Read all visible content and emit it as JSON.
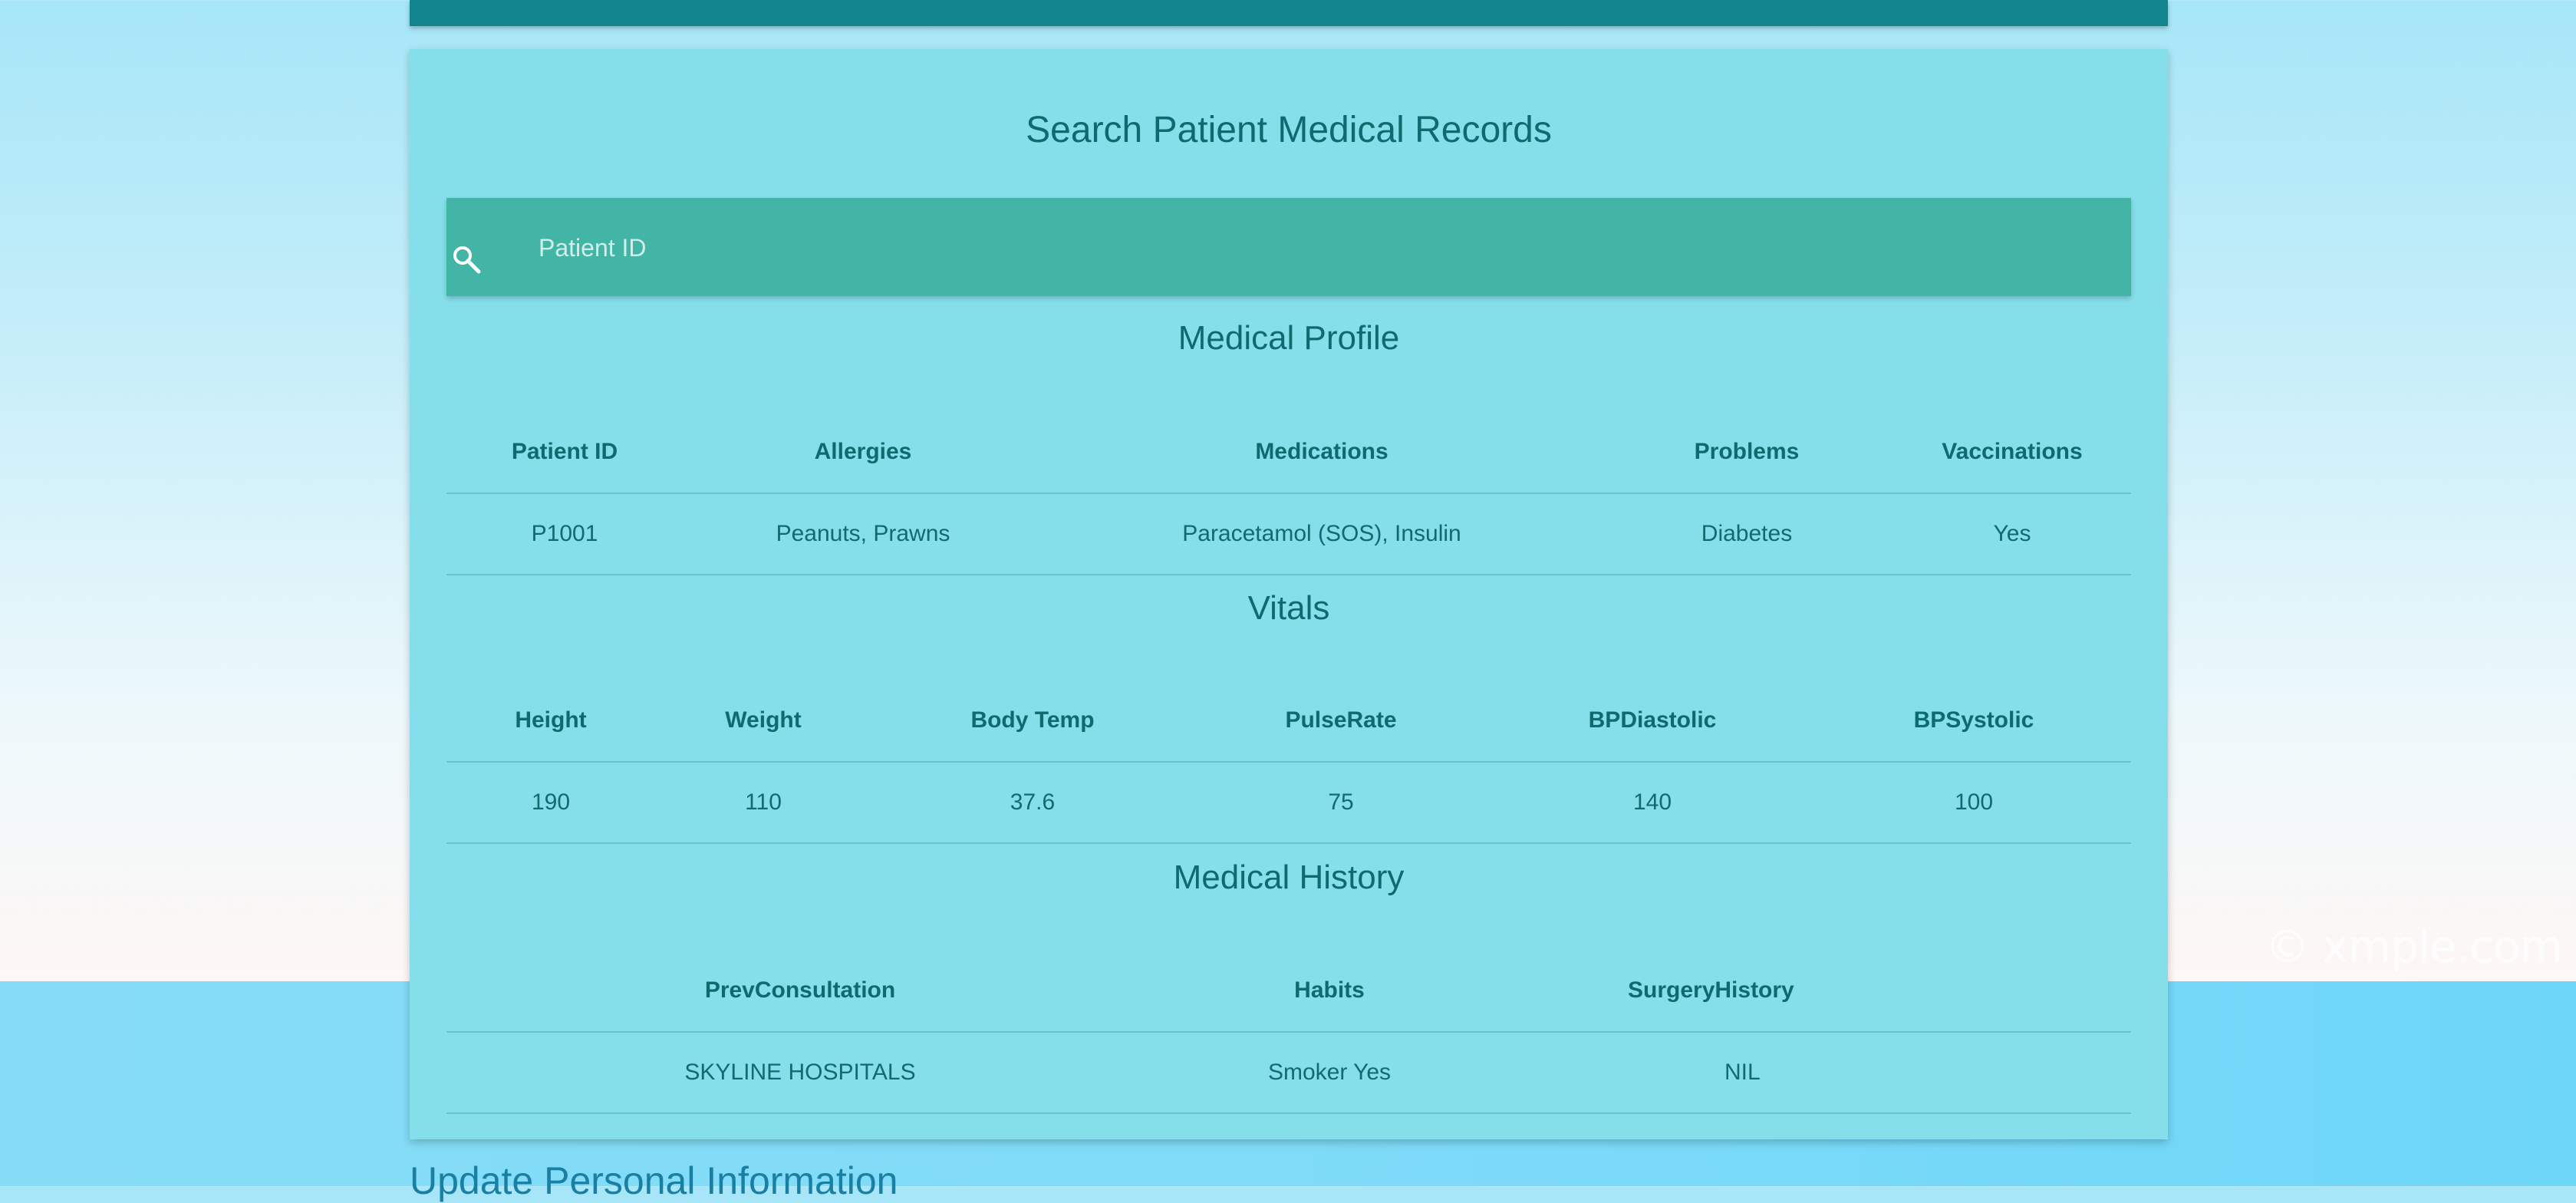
{
  "watermark": "© xmple.com",
  "card": {
    "title": "Search Patient Medical Records",
    "search": {
      "placeholder": "Patient ID",
      "value": ""
    }
  },
  "medical_profile": {
    "title": "Medical Profile",
    "headers": [
      "Patient ID",
      "Allergies",
      "Medications",
      "Problems",
      "Vaccinations"
    ],
    "rows": [
      [
        "P1001",
        "Peanuts, Prawns",
        "Paracetamol (SOS), Insulin",
        "Diabetes",
        "Yes"
      ]
    ]
  },
  "vitals": {
    "title": "Vitals",
    "headers": [
      "Height",
      "Weight",
      "Body Temp",
      "PulseRate",
      "BPDiastolic",
      "BPSystolic"
    ],
    "rows": [
      [
        "190",
        "110",
        "37.6",
        "75",
        "140",
        "100"
      ]
    ]
  },
  "medical_history": {
    "title": "Medical History",
    "headers": [
      "PrevConsultation",
      "Habits",
      "SurgeryHistory"
    ],
    "rows": [
      [
        "SKYLINE HOSPITALS",
        "Smoker Yes",
        "NIL"
      ]
    ]
  },
  "next_section": {
    "title": "Update Personal Information"
  },
  "colors": {
    "top_bar": "#11848e",
    "card_bg": "#84dfea",
    "search_bar": "#42b5a7",
    "heading_text": "#0c6b6f"
  },
  "icons": {
    "search": "search-icon"
  }
}
